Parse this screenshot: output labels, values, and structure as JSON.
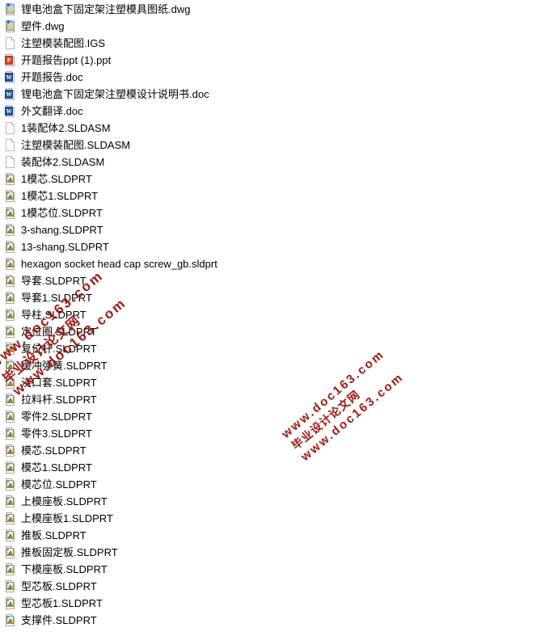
{
  "page": {
    "background": "#ffffff",
    "text_color": "#000000",
    "watermark_color": "#9e1915"
  },
  "file_list": {
    "items": [
      {
        "name": "锂电池盒下固定架注塑模具图纸.dwg",
        "icon": "dwg-file-icon",
        "type": "dwg"
      },
      {
        "name": "塑件.dwg",
        "icon": "dwg-file-icon",
        "type": "dwg"
      },
      {
        "name": "注塑模装配图.IGS",
        "icon": "blank-file-icon",
        "type": "blank"
      },
      {
        "name": "开题报告ppt (1).ppt",
        "icon": "powerpoint-file-icon",
        "type": "ppt"
      },
      {
        "name": "开题报告.doc",
        "icon": "word-file-icon",
        "type": "doc"
      },
      {
        "name": "锂电池盒下固定架注塑模设计说明书.doc",
        "icon": "word-file-icon",
        "type": "doc"
      },
      {
        "name": "外文翻译.doc",
        "icon": "word-file-icon",
        "type": "doc"
      },
      {
        "name": "1装配体2.SLDASM",
        "icon": "blank-file-icon",
        "type": "blank"
      },
      {
        "name": "注塑模装配图.SLDASM",
        "icon": "blank-file-icon",
        "type": "blank"
      },
      {
        "name": "装配体2.SLDASM",
        "icon": "blank-file-icon",
        "type": "blank"
      },
      {
        "name": "1模芯.SLDPRT",
        "icon": "solidworks-part-icon",
        "type": "prt"
      },
      {
        "name": "1模芯1.SLDPRT",
        "icon": "solidworks-part-icon",
        "type": "prt"
      },
      {
        "name": "1模芯位.SLDPRT",
        "icon": "solidworks-part-icon",
        "type": "prt"
      },
      {
        "name": "3-shang.SLDPRT",
        "icon": "solidworks-part-icon",
        "type": "prt"
      },
      {
        "name": "13-shang.SLDPRT",
        "icon": "solidworks-part-icon",
        "type": "prt"
      },
      {
        "name": "hexagon socket head cap screw_gb.sldprt",
        "icon": "solidworks-part-icon",
        "type": "prt"
      },
      {
        "name": "导套.SLDPRT",
        "icon": "solidworks-part-icon",
        "type": "prt"
      },
      {
        "name": "导套1.SLDPRT",
        "icon": "solidworks-part-icon",
        "type": "prt"
      },
      {
        "name": "导柱.SLDPRT",
        "icon": "solidworks-part-icon",
        "type": "prt"
      },
      {
        "name": "定位圈.SLDPRT",
        "icon": "solidworks-part-icon",
        "type": "prt"
      },
      {
        "name": "复位杆.SLDPRT",
        "icon": "solidworks-part-icon",
        "type": "prt"
      },
      {
        "name": "缓冲弹簧.SLDPRT",
        "icon": "solidworks-part-icon",
        "type": "prt"
      },
      {
        "name": "浇口套.SLDPRT",
        "icon": "solidworks-part-icon",
        "type": "prt"
      },
      {
        "name": "拉料杆.SLDPRT",
        "icon": "solidworks-part-icon",
        "type": "prt"
      },
      {
        "name": "零件2.SLDPRT",
        "icon": "solidworks-part-icon",
        "type": "prt"
      },
      {
        "name": "零件3.SLDPRT",
        "icon": "solidworks-part-icon",
        "type": "prt"
      },
      {
        "name": "模芯.SLDPRT",
        "icon": "solidworks-part-icon",
        "type": "prt"
      },
      {
        "name": "模芯1.SLDPRT",
        "icon": "solidworks-part-icon",
        "type": "prt"
      },
      {
        "name": "模芯位.SLDPRT",
        "icon": "solidworks-part-icon",
        "type": "prt"
      },
      {
        "name": "上模座板.SLDPRT",
        "icon": "solidworks-part-icon",
        "type": "prt"
      },
      {
        "name": "上模座板1.SLDPRT",
        "icon": "solidworks-part-icon",
        "type": "prt"
      },
      {
        "name": "推板.SLDPRT",
        "icon": "solidworks-part-icon",
        "type": "prt"
      },
      {
        "name": "推板固定板.SLDPRT",
        "icon": "solidworks-part-icon",
        "type": "prt"
      },
      {
        "name": "下模座板.SLDPRT",
        "icon": "solidworks-part-icon",
        "type": "prt"
      },
      {
        "name": "型芯板.SLDPRT",
        "icon": "solidworks-part-icon",
        "type": "prt"
      },
      {
        "name": "型芯板1.SLDPRT",
        "icon": "solidworks-part-icon",
        "type": "prt"
      },
      {
        "name": "支撑件.SLDPRT",
        "icon": "solidworks-part-icon",
        "type": "prt"
      }
    ]
  },
  "watermarks": [
    {
      "line_cn": "毕业设计论文网",
      "line_url": "www.doc163.com"
    },
    {
      "line_cn": "毕业设计论文网",
      "line_url": "www.doc163.com"
    }
  ],
  "icon_badges": {
    "ppt": "P",
    "doc": "W",
    "dwg_marker": "✦"
  }
}
